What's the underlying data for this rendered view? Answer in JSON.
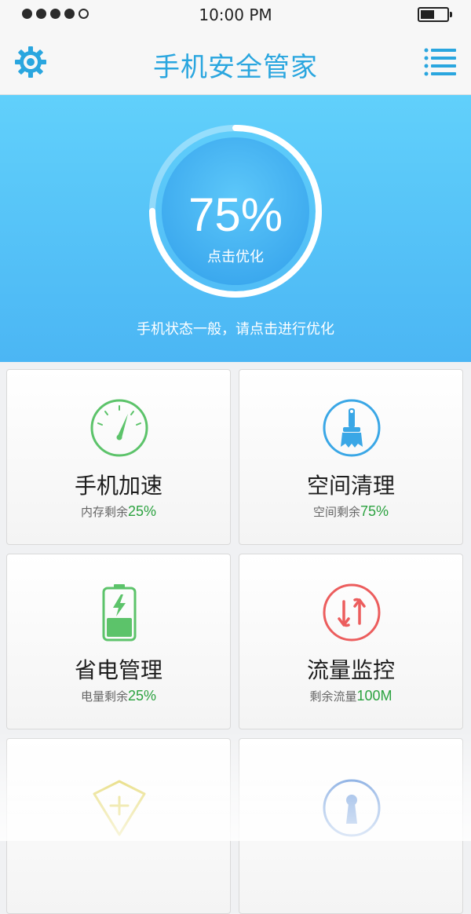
{
  "status_bar": {
    "signal_bars": 4,
    "time": "10:00 PM",
    "battery_level": 0.45
  },
  "nav": {
    "title": "手机安全管家",
    "left_icon": "gear-icon",
    "right_icon": "menu-icon",
    "accent_color": "#2aa6df"
  },
  "hero": {
    "score": "75%",
    "score_value": 75,
    "action_hint": "点击优化",
    "status_text": "手机状态一般，请点击进行优化",
    "background_color": "#57c4f8"
  },
  "cards": [
    {
      "id": "speedup",
      "icon": "speedometer-icon",
      "title": "手机加速",
      "sub_label": "内存剩余",
      "sub_value": "25%",
      "color": "#5cc36a"
    },
    {
      "id": "cleanup",
      "icon": "brush-icon",
      "title": "空间清理",
      "sub_label": "空间剩余",
      "sub_value": "75%",
      "color": "#3aa7e6"
    },
    {
      "id": "power",
      "icon": "battery-charging-icon",
      "title": "省电管理",
      "sub_label": "电量剩余",
      "sub_value": "25%",
      "color": "#5cc36a"
    },
    {
      "id": "traffic",
      "icon": "data-transfer-icon",
      "title": "流量监控",
      "sub_label": "剩余流量",
      "sub_value": "100M",
      "color": "#ec5d5d"
    },
    {
      "id": "protect",
      "icon": "shield-plus-icon",
      "title": "",
      "sub_label": "",
      "sub_value": "",
      "color": "#d8c62c"
    },
    {
      "id": "privacy",
      "icon": "keyhole-icon",
      "title": "",
      "sub_label": "",
      "sub_value": "",
      "color": "#3a78d0"
    }
  ]
}
